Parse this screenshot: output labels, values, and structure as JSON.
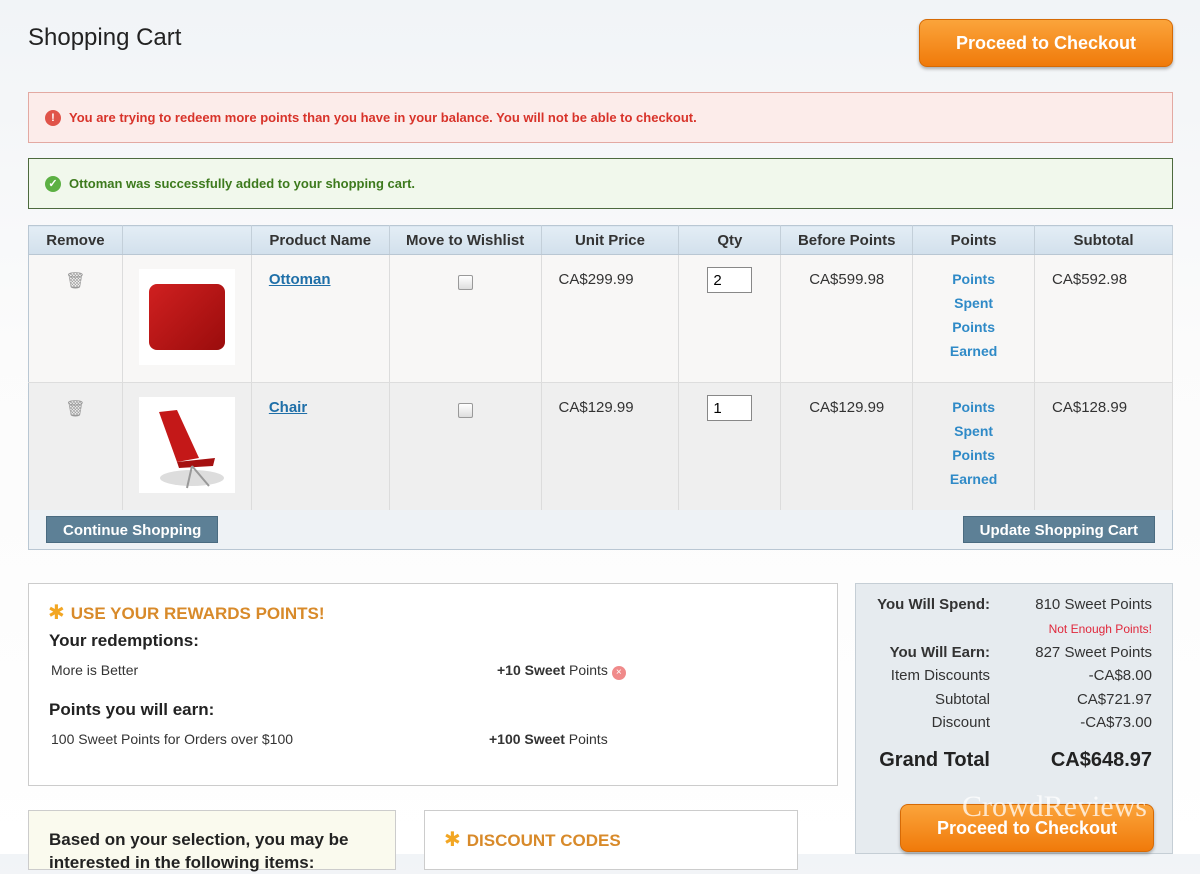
{
  "page": {
    "title": "Shopping Cart",
    "checkout_label": "Proceed to Checkout"
  },
  "messages": {
    "error": "You are trying to redeem more points than you have in your balance. You will not be able to checkout.",
    "success": "Ottoman was successfully added to your shopping cart."
  },
  "colors": {
    "accent": "#f07a0a",
    "error_text": "#d8332a",
    "success_text": "#3d7a1d"
  },
  "cart": {
    "headers": [
      "Remove",
      "",
      "Product Name",
      "Move to Wishlist",
      "Unit Price",
      "Qty",
      "Before Points",
      "Points",
      "Subtotal"
    ],
    "items": [
      {
        "name": "Ottoman",
        "unit_price": "CA$299.99",
        "qty": "2",
        "before_points": "CA$599.98",
        "points": [
          "Points",
          "Spent",
          "Points",
          "Earned"
        ],
        "subtotal": "CA$592.98"
      },
      {
        "name": "Chair",
        "unit_price": "CA$129.99",
        "qty": "1",
        "before_points": "CA$129.99",
        "points": [
          "Points",
          "Spent",
          "Points",
          "Earned"
        ],
        "subtotal": "CA$128.99"
      }
    ],
    "continue_label": "Continue Shopping",
    "update_label": "Update Shopping Cart"
  },
  "rewards": {
    "title": "USE YOUR REWARDS POINTS!",
    "redemptions_label": "Your redemptions:",
    "redemption": {
      "name": "More is Better",
      "value_bold": "+10 Sweet",
      "value_rest": " Points"
    },
    "earn_label": "Points you will earn:",
    "earn": {
      "name": "100 Sweet Points for Orders over $100",
      "value_bold": "+100 Sweet",
      "value_rest": " Points"
    }
  },
  "crosssell": {
    "text": "Based on your selection, you may be interested in the following items:"
  },
  "discount": {
    "title": "DISCOUNT CODES"
  },
  "totals": {
    "spend_label": "You Will Spend:",
    "spend_value": "810 Sweet Points",
    "warning": "Not Enough Points!",
    "earn_label": "You Will Earn:",
    "earn_value": "827 Sweet Points",
    "item_discounts_label": "Item Discounts",
    "item_discounts_value": "-CA$8.00",
    "subtotal_label": "Subtotal",
    "subtotal_value": "CA$721.97",
    "discount_label": "Discount",
    "discount_value": "-CA$73.00",
    "grand_label": "Grand Total",
    "grand_value": "CA$648.97"
  },
  "watermark": "CrowdReviews"
}
